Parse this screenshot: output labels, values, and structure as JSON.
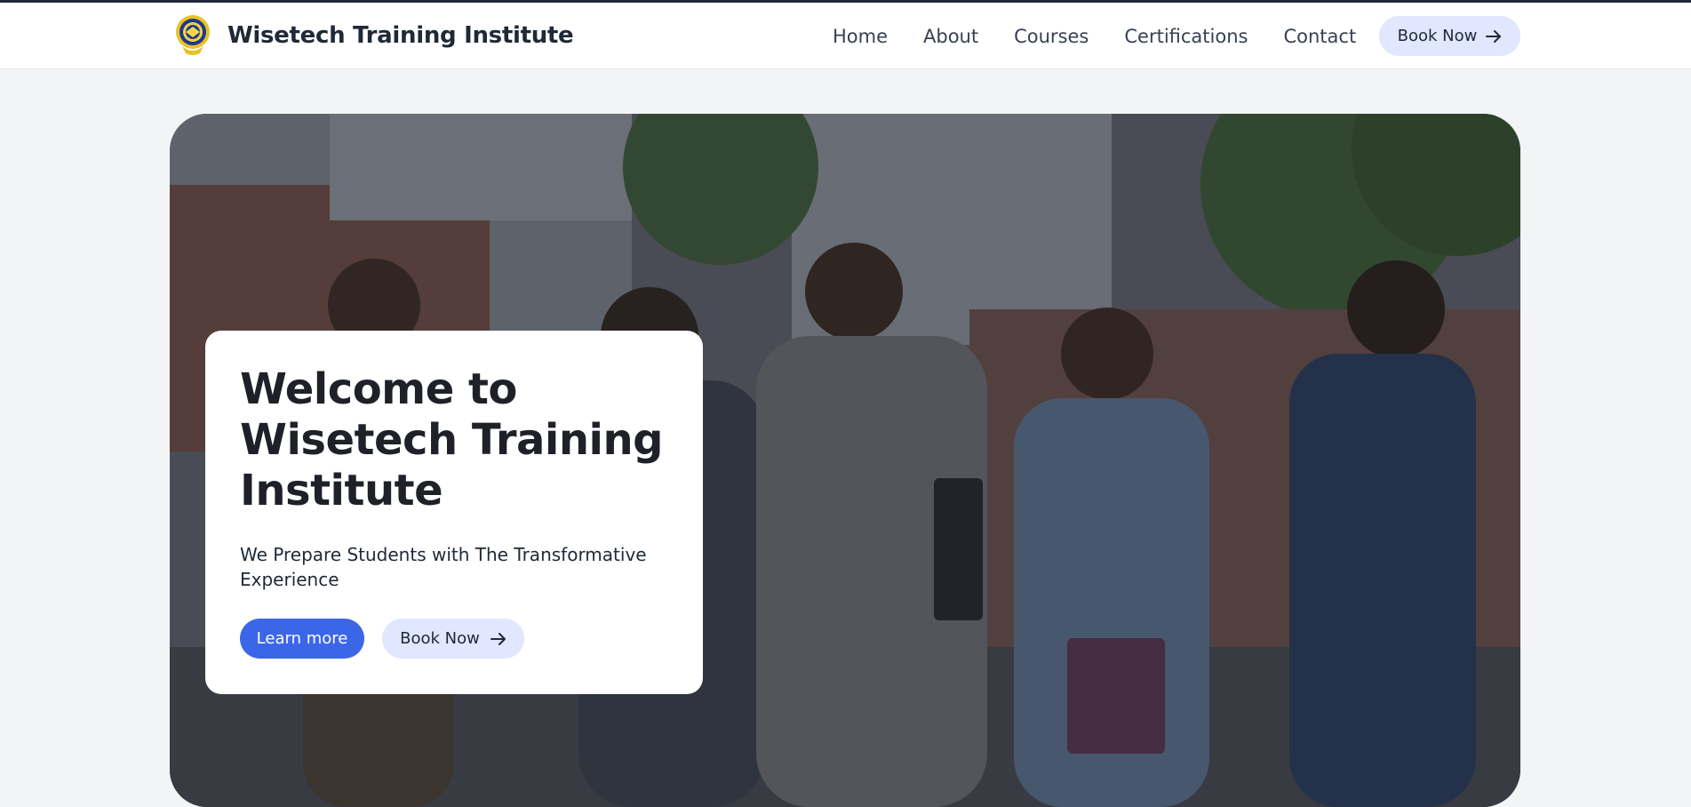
{
  "header": {
    "brand_name": "Wisetech Training Institute",
    "nav": [
      {
        "label": "Home"
      },
      {
        "label": "About"
      },
      {
        "label": "Courses"
      },
      {
        "label": "Certifications"
      },
      {
        "label": "Contact"
      }
    ],
    "cta_label": "Book Now"
  },
  "hero": {
    "title": "Welcome to Wisetech Training Institute",
    "subtitle": "We Prepare Students with The Transformative Experience",
    "primary_button": "Learn more",
    "secondary_button": "Book Now"
  },
  "colors": {
    "accent": "#3b66e8",
    "secondary_button_bg": "#e0e7ff",
    "page_bg": "#f3f4f6"
  },
  "icons": [
    "institute-logo-icon",
    "arrow-right-icon"
  ]
}
